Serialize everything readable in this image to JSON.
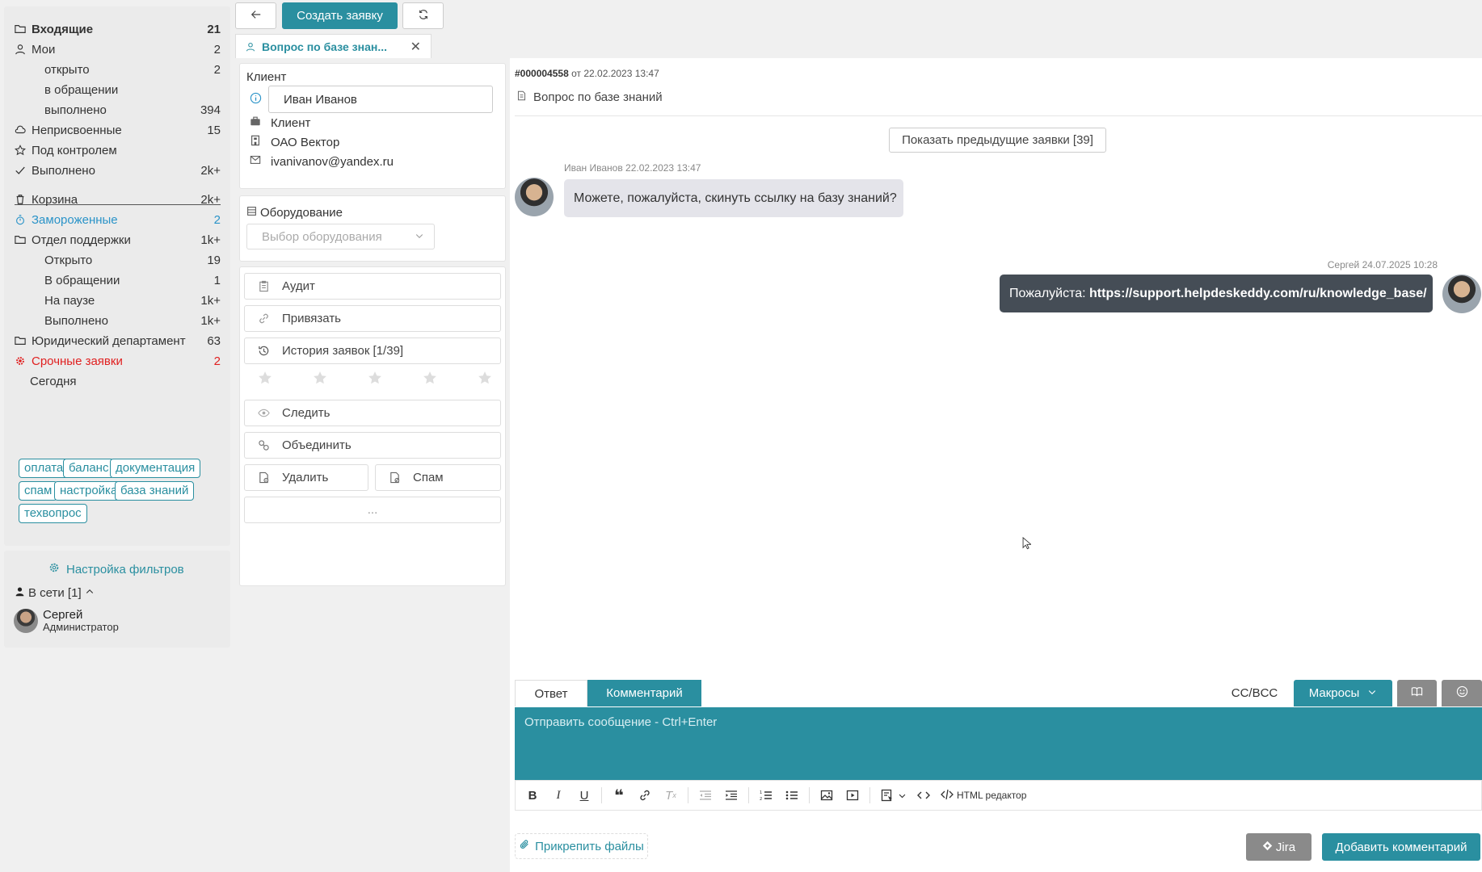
{
  "sidebar": {
    "items": [
      {
        "label": "Входящие",
        "count": "21"
      },
      {
        "label": "Мои",
        "count": "2"
      },
      {
        "label": "открыто",
        "count": "2"
      },
      {
        "label": "в обращении",
        "count": ""
      },
      {
        "label": "выполнено",
        "count": "394"
      },
      {
        "label": "Неприсвоенные",
        "count": "15"
      },
      {
        "label": "Под контролем",
        "count": ""
      },
      {
        "label": "Выполнено",
        "count": "2k+"
      },
      {
        "label": "Корзина",
        "count": "2k+"
      },
      {
        "label": "Замороженные",
        "count": "2"
      },
      {
        "label": "Отдел поддержки",
        "count": "1k+"
      },
      {
        "label": "Открыто",
        "count": "19"
      },
      {
        "label": "В обращении",
        "count": "1"
      },
      {
        "label": "На паузе",
        "count": "1k+"
      },
      {
        "label": "Выполнено",
        "count": "1k+"
      },
      {
        "label": "Юридический департамент",
        "count": "63"
      },
      {
        "label": "Срочные заявки",
        "count": "2"
      },
      {
        "label": "Сегодня",
        "count": ""
      }
    ],
    "tags": [
      "оплата",
      "баланс",
      "документация",
      "спам",
      "настройка",
      "база знаний",
      "техвопрос"
    ],
    "filters_link": "Настройка фильтров",
    "online_label": "В сети [1]",
    "user": {
      "name": "Сергей",
      "role": "Администратор"
    }
  },
  "topbar": {
    "create_label": "Создать заявку",
    "tab_title": "Вопрос по базе знан..."
  },
  "client_card": {
    "title": "Клиент",
    "name_value": "Иван Иванов",
    "type": "Клиент",
    "company": "ОАО Вектор",
    "email": "ivanivanov@yandex.ru"
  },
  "equipment_card": {
    "title": "Оборудование",
    "placeholder": "Выбор оборудования"
  },
  "actions": {
    "audit": "Аудит",
    "link": "Привязать",
    "history": "История заявок [1/39]",
    "follow": "Следить",
    "merge": "Объединить",
    "delete": "Удалить",
    "spam": "Спам",
    "more": "..."
  },
  "rating": {
    "value": 0,
    "max": 5
  },
  "ticket": {
    "number": "#000004558",
    "date_text": "от 22.02.2023 13:47",
    "subject": "Вопрос по базе знаний",
    "prev_button": "Показать предыдущие заявки [39]"
  },
  "messages": [
    {
      "author_time": "Иван Иванов 22.02.2023 13:47",
      "text": "Можете, пожалуйста, скинуть ссылку на базу знаний?"
    },
    {
      "author_time": "Сергей 24.07.2025 10:28",
      "prefix": "Пожалуйста: ",
      "link": "https://support.helpdeskeddy.com/ru/knowledge_base/"
    }
  ],
  "reply": {
    "tab_reply": "Ответ",
    "tab_comment": "Комментарий",
    "cc_bcc": "CC/BCC",
    "macros": "Макросы",
    "placeholder": "Отправить сообщение - Ctrl+Enter",
    "html_editor": "HTML редактор",
    "attach": "Прикрепить файлы",
    "jira": "Jira",
    "submit": "Добавить комментарий"
  },
  "colors": {
    "accent": "#2a8fa0",
    "urgent": "#e02020",
    "frozen": "#2a93c8",
    "outgoing_bubble": "#454d56"
  }
}
